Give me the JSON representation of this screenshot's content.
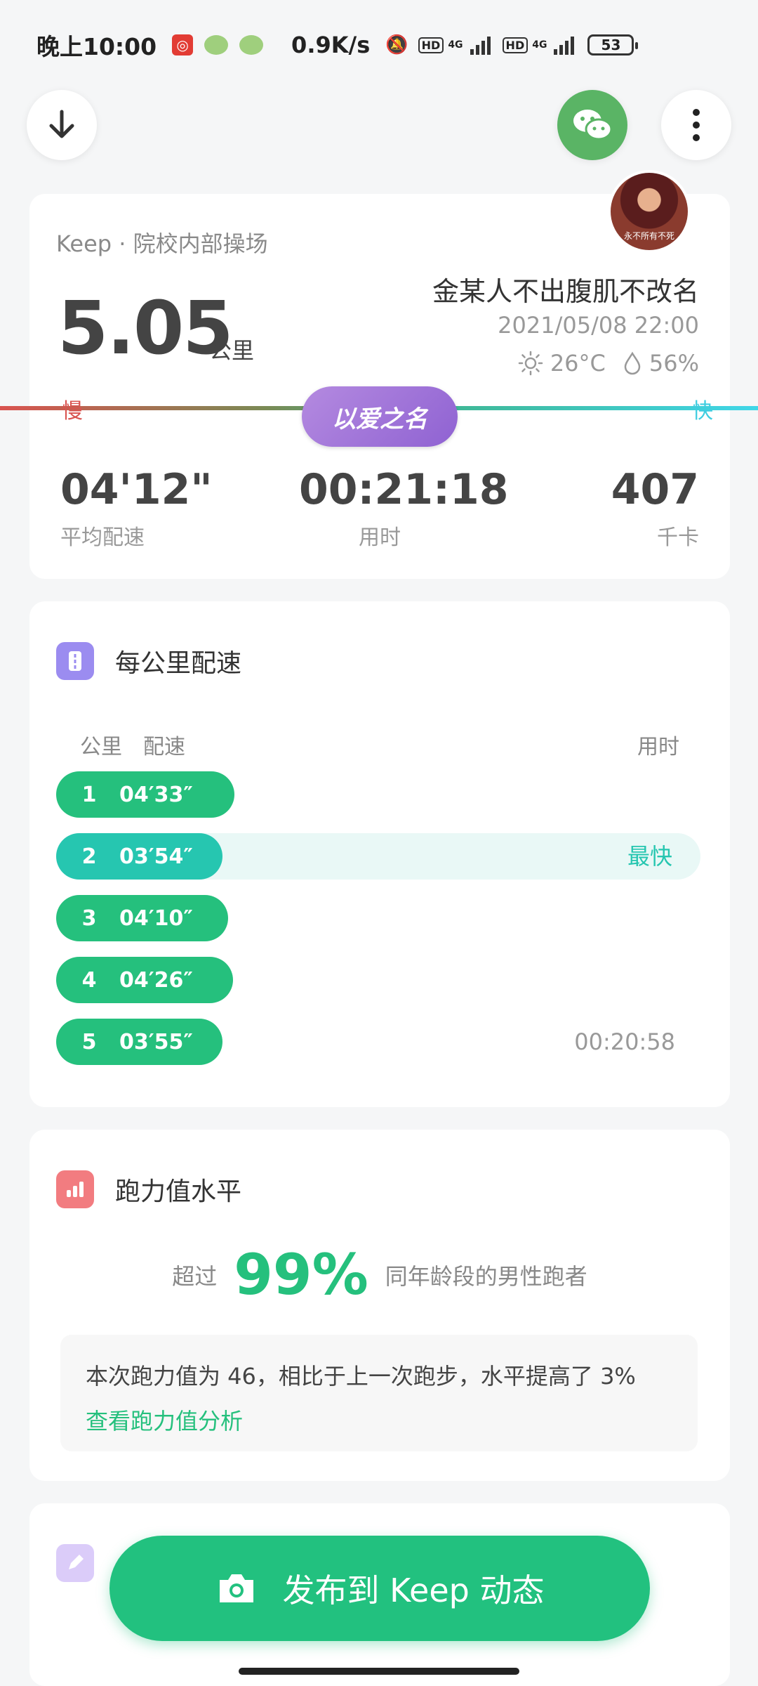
{
  "status": {
    "time": "晚上10:00",
    "speed": "0.9K/s",
    "hd1": "HD",
    "sig1": "4G",
    "hd2": "HD",
    "sig2": "4G",
    "battery": "53"
  },
  "header": {
    "colors": {
      "wechat": "#5ab465"
    }
  },
  "summary": {
    "location": "Keep · 院校内部操场",
    "avatar_caption": "永不所有不死",
    "distance": "5.05",
    "distance_unit": "公里",
    "title": "金某人不出腹肌不改名",
    "datetime": "2021/05/08 22:00",
    "temperature": "26°C",
    "humidity": "56%",
    "slow_label": "慢",
    "fast_label": "快",
    "badge": "以爱之名",
    "avg_pace": "04'12\"",
    "avg_pace_label": "平均配速",
    "duration": "00:21:18",
    "duration_label": "用时",
    "calories": "407",
    "calories_label": "千卡"
  },
  "pace": {
    "title": "每公里配速",
    "col_km": "公里",
    "col_pace": "配速",
    "col_time": "用时",
    "rows": [
      {
        "km": "1",
        "pace": "04′33″",
        "fill": 0.277
      },
      {
        "km": "2",
        "pace": "03′54″",
        "fill": 0.258,
        "note": "最快"
      },
      {
        "km": "3",
        "pace": "04′10″",
        "fill": 0.267
      },
      {
        "km": "4",
        "pace": "04′26″",
        "fill": 0.274
      },
      {
        "km": "5",
        "pace": "03′55″",
        "fill": 0.258,
        "time": "00:20:58"
      }
    ]
  },
  "level": {
    "title": "跑力值水平",
    "prefix": "超过",
    "percent": "99%",
    "suffix": "同年龄段的男性跑者",
    "detail": "本次跑力值为 46，相比于上一次跑步，水平提高了 3%",
    "link": "查看跑力值分析"
  },
  "publish": {
    "label": "发布到 Keep 动态"
  }
}
